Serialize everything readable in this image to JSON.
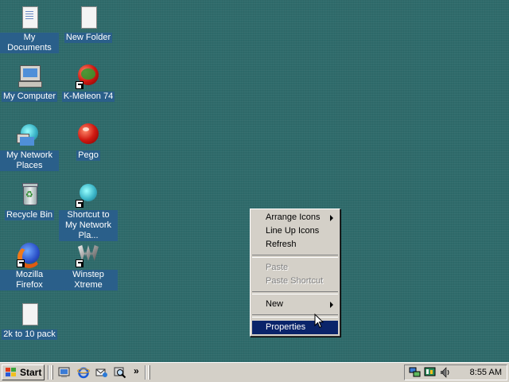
{
  "desktop": {
    "icons": [
      {
        "label": "My Documents",
        "icon": "my-documents-icon"
      },
      {
        "label": "New Folder",
        "icon": "new-folder-icon"
      },
      {
        "label": "My Computer",
        "icon": "my-computer-icon"
      },
      {
        "label": "K-Meleon 74",
        "icon": "k-meleon-icon"
      },
      {
        "label": "My Network Places",
        "icon": "network-places-icon"
      },
      {
        "label": "Pego",
        "icon": "pego-icon"
      },
      {
        "label": "Recycle Bin",
        "icon": "recycle-bin-icon"
      },
      {
        "label": "Shortcut to My Network Pla...",
        "icon": "network-shortcut-icon"
      },
      {
        "label": "Mozilla Firefox",
        "icon": "firefox-icon"
      },
      {
        "label": "Winstep Xtreme",
        "icon": "winstep-icon"
      },
      {
        "label": "2k to 10 pack",
        "icon": "document-icon"
      }
    ]
  },
  "context_menu": {
    "items": [
      {
        "label": "Arrange Icons",
        "submenu": true,
        "disabled": false
      },
      {
        "label": "Line Up Icons",
        "submenu": false,
        "disabled": false
      },
      {
        "label": "Refresh",
        "submenu": false,
        "disabled": false
      },
      {
        "label": "Paste",
        "submenu": false,
        "disabled": true
      },
      {
        "label": "Paste Shortcut",
        "submenu": false,
        "disabled": true
      },
      {
        "label": "New",
        "submenu": true,
        "disabled": false
      },
      {
        "label": "Properties",
        "submenu": false,
        "disabled": false,
        "selected": true
      }
    ]
  },
  "taskbar": {
    "start_label": "Start",
    "chevron": "»",
    "quick_launch": [
      "show-desktop-icon",
      "internet-explorer-icon",
      "outlook-express-icon",
      "search-icon"
    ],
    "tray_icons": [
      "network-tray-icon",
      "display-tray-icon",
      "volume-tray-icon"
    ],
    "clock": "8:55 AM"
  },
  "colors": {
    "desktop_bg": "#2f6b6b",
    "menu_bg": "#d4d0c8",
    "selection": "#0a246a",
    "icon_label_bg": "#2a5f8a"
  }
}
